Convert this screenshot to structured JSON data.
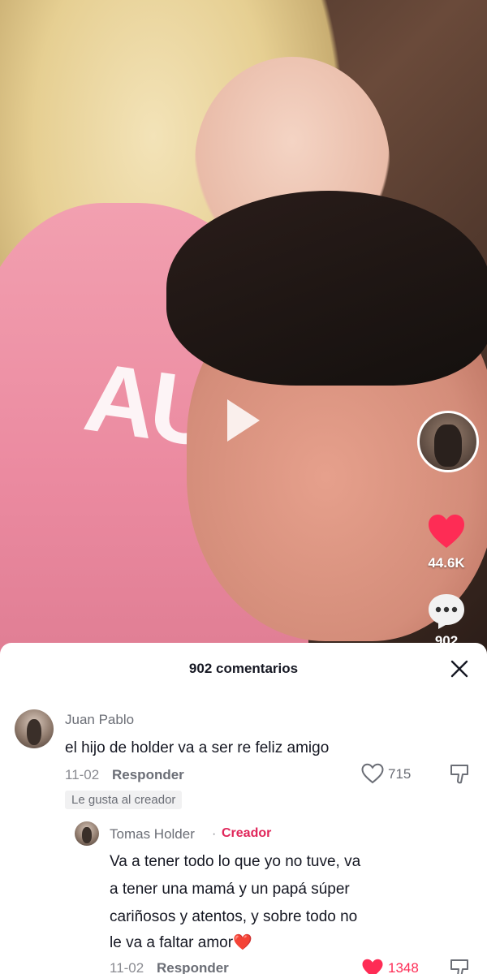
{
  "video": {
    "likes": "44.6K",
    "comments": "902",
    "shirt_text": "AU"
  },
  "sheet": {
    "title": "902 comentarios"
  },
  "comments": [
    {
      "author": "Juan Pablo",
      "text": "el hijo de holder va a ser re feliz amigo",
      "date": "11-02",
      "reply_label": "Responder",
      "likes": "715",
      "badge": "Le gusta al creador"
    }
  ],
  "reply": {
    "author": "Tomas Holder",
    "separator": "·",
    "role": "Creador",
    "text_lines": [
      "Va a tener todo lo que yo no tuve, va",
      "a tener una mamá y un papá súper",
      "cariñosos y atentos, y sobre todo no",
      "le va a faltar amor❤️"
    ],
    "date": "11-02",
    "reply_label": "Responder",
    "likes": "1348"
  },
  "colors": {
    "accent": "#fe2c55",
    "creator": "#e0265a",
    "text_primary": "#161823",
    "text_secondary": "#6b6e76"
  }
}
